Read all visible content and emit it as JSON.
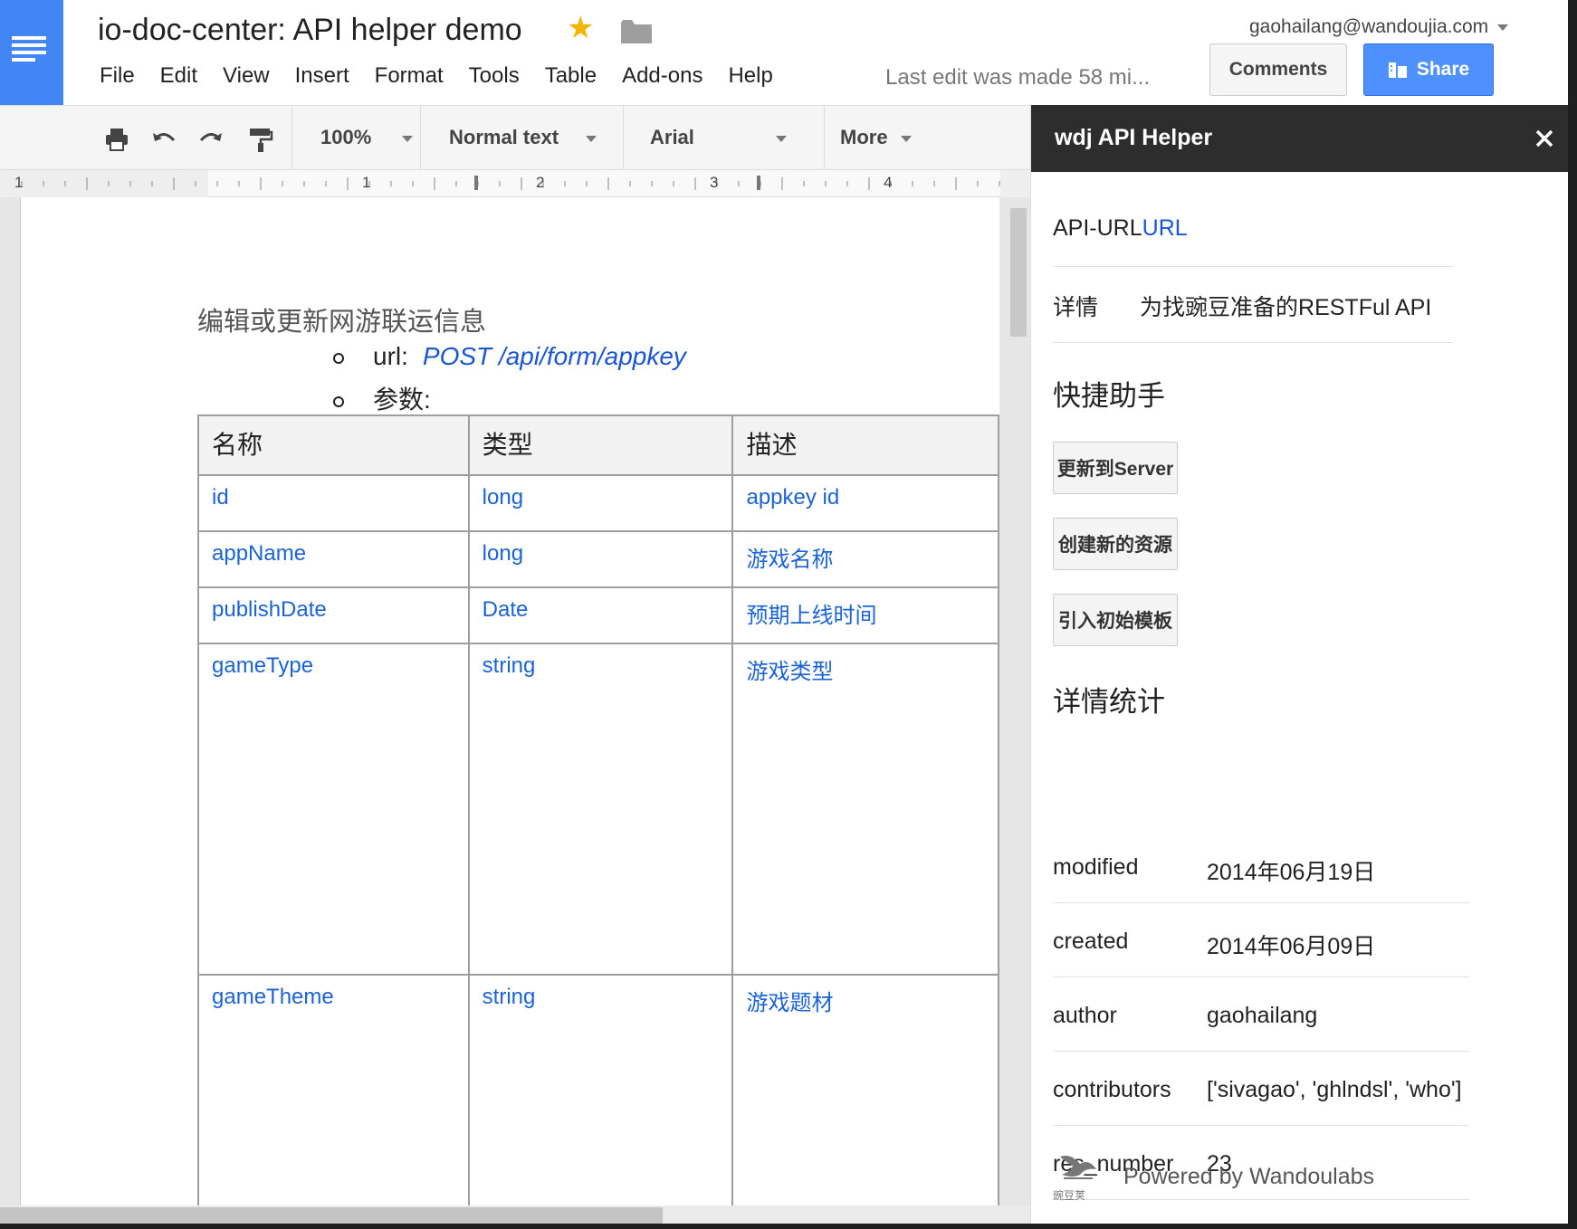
{
  "header": {
    "doc_title": "io-doc-center: API helper demo",
    "menus": [
      "File",
      "Edit",
      "View",
      "Insert",
      "Format",
      "Tools",
      "Table",
      "Add-ons",
      "Help"
    ],
    "last_edit": "Last edit was made 58 mi...",
    "account": "gaohailang@wandoujia.com",
    "comments_label": "Comments",
    "share_label": "Share"
  },
  "toolbar": {
    "zoom": "100%",
    "style": "Normal text",
    "font": "Arial",
    "more": "More"
  },
  "ruler": {
    "numbers": [
      "1",
      "1",
      "2",
      "3",
      "4"
    ]
  },
  "document": {
    "heading": "编辑或更新网游联运信息",
    "url_label": "url:",
    "url_value": "POST /api/form/appkey",
    "params_label": "参数:",
    "table": {
      "headers": [
        "名称",
        "类型",
        "描述"
      ],
      "rows": [
        [
          "id",
          "long",
          "appkey id"
        ],
        [
          "appName",
          "long",
          "游戏名称"
        ],
        [
          "publishDate",
          "Date",
          "预期上线时间"
        ],
        [
          "gameType",
          "string",
          "游戏类型"
        ],
        [
          "gameTheme",
          "string",
          "游戏题材"
        ]
      ]
    }
  },
  "sidebar": {
    "title": "wdj API Helper",
    "url_label": "API-URL",
    "url_link": "URL",
    "detail_label": "详情",
    "detail_value": "为找豌豆准备的RESTFul API",
    "quick_title": "快捷助手",
    "buttons": [
      "更新到Server",
      "创建新的资源",
      "引入初始模板"
    ],
    "stats_title": "详情统计",
    "stats": [
      {
        "key": "modified",
        "value": "2014年06月19日"
      },
      {
        "key": "created",
        "value": "2014年06月09日"
      },
      {
        "key": "author",
        "value": "gaohailang"
      },
      {
        "key": "contributors",
        "value": "['sivagao', 'ghlndsl', 'who']"
      },
      {
        "key": "res_number",
        "value": "23"
      }
    ],
    "powered_by": "Powered by Wandoulabs",
    "logo_text": "豌豆荚"
  },
  "colors": {
    "docs_blue": "#4285f4",
    "share_blue": "#4d90fe",
    "link_blue": "#1a55d6",
    "sidebar_header": "#2d2d2d",
    "star": "#f4b400"
  }
}
